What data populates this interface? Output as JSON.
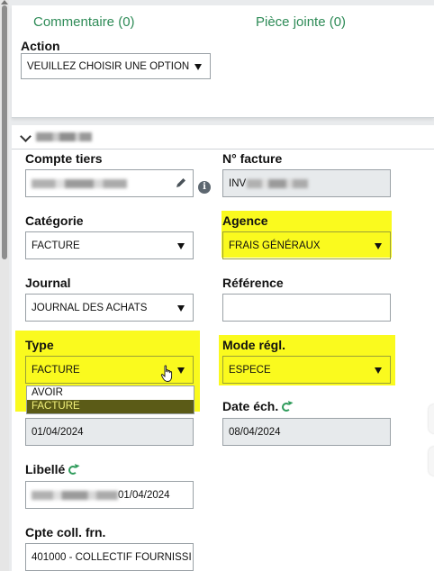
{
  "tabs": {
    "comment": "Commentaire (0)",
    "attachment": "Pièce jointe (0)"
  },
  "action": {
    "label": "Action",
    "value": "VEUILLEZ CHOISIR UNE OPTION"
  },
  "form": {
    "compte_tiers": {
      "label": "Compte tiers"
    },
    "n_facture": {
      "label": "N° facture",
      "value_prefix": "INV"
    },
    "categorie": {
      "label": "Catégorie",
      "value": "FACTURE"
    },
    "agence": {
      "label": "Agence",
      "value": "FRAIS GÉNÉRAUX"
    },
    "journal": {
      "label": "Journal",
      "value": "JOURNAL DES ACHATS"
    },
    "reference": {
      "label": "Référence",
      "value": ""
    },
    "type": {
      "label": "Type",
      "value": "FACTURE",
      "options": [
        "AVOIR",
        "FACTURE"
      ]
    },
    "mode_regl": {
      "label": "Mode régl.",
      "value": "ESPECE"
    },
    "date_piece": {
      "value": "01/04/2024"
    },
    "date_ech": {
      "label": "Date éch.",
      "value": "08/04/2024"
    },
    "libelle": {
      "label": "Libellé",
      "value_suffix": "01/04/2024"
    },
    "cpte_coll": {
      "label": "Cpte coll. frn.",
      "value": "401000 - COLLECTIF FOURNISSI"
    }
  },
  "colors": {
    "accent_green": "#2e8b57",
    "highlight": "#fafa1e",
    "selected_option_bg": "#5b5b17"
  }
}
